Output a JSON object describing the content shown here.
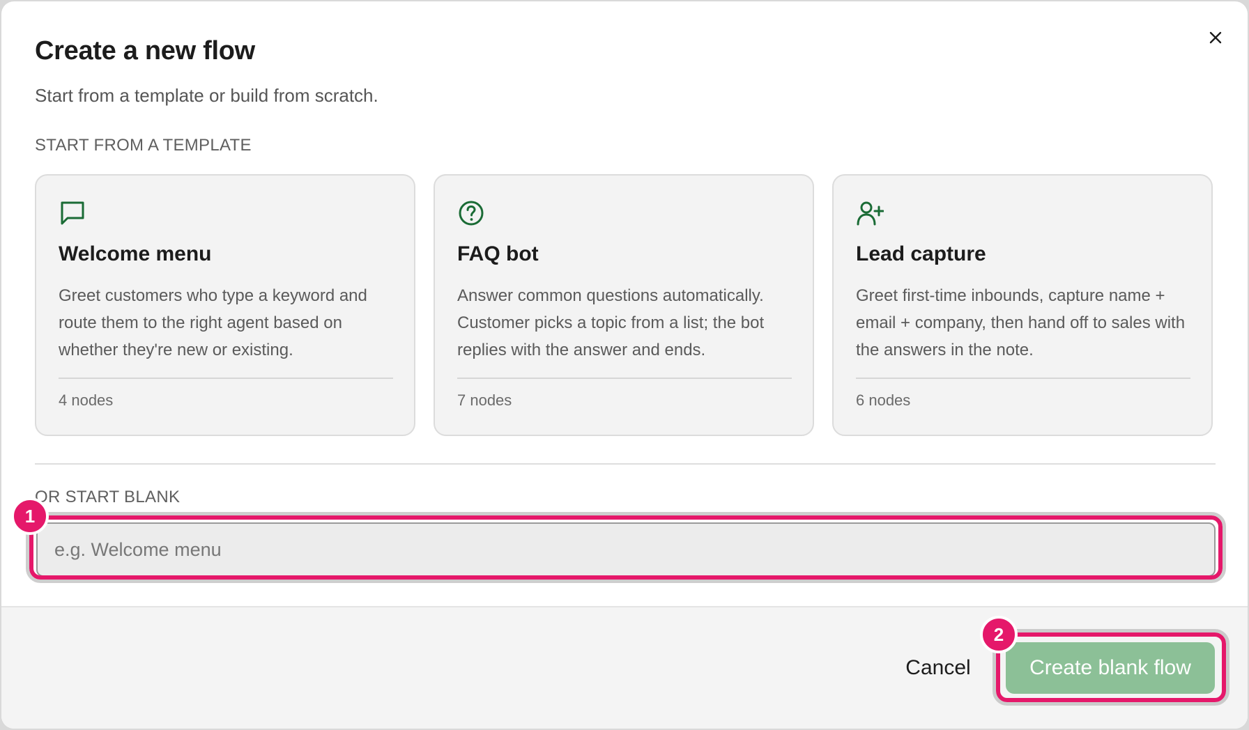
{
  "dialog": {
    "title": "Create a new flow",
    "subtitle": "Start from a template or build from scratch.",
    "close_icon": "close-icon"
  },
  "templates": {
    "section_label": "START FROM A TEMPLATE",
    "accent_color": "#1a6b35",
    "items": [
      {
        "icon": "chat-bubble-icon",
        "title": "Welcome menu",
        "description": "Greet customers who type a keyword and route them to the right agent based on whether they're new or existing.",
        "meta": "4 nodes"
      },
      {
        "icon": "question-circle-icon",
        "title": "FAQ bot",
        "description": "Answer common questions automatically. Customer picks a topic from a list; the bot replies with the answer and ends.",
        "meta": "7 nodes"
      },
      {
        "icon": "user-plus-icon",
        "title": "Lead capture",
        "description": "Greet first-time inbounds, capture name + email + company, then hand off to sales with the answers in the note.",
        "meta": "6 nodes"
      }
    ]
  },
  "blank": {
    "section_label": "OR START BLANK",
    "input_value": "",
    "input_placeholder": "e.g. Welcome menu"
  },
  "footer": {
    "cancel_label": "Cancel",
    "create_label": "Create blank flow",
    "create_color": "#8cc097"
  },
  "annotations": {
    "highlight_color": "#e5186a",
    "badges": [
      "1",
      "2"
    ]
  }
}
